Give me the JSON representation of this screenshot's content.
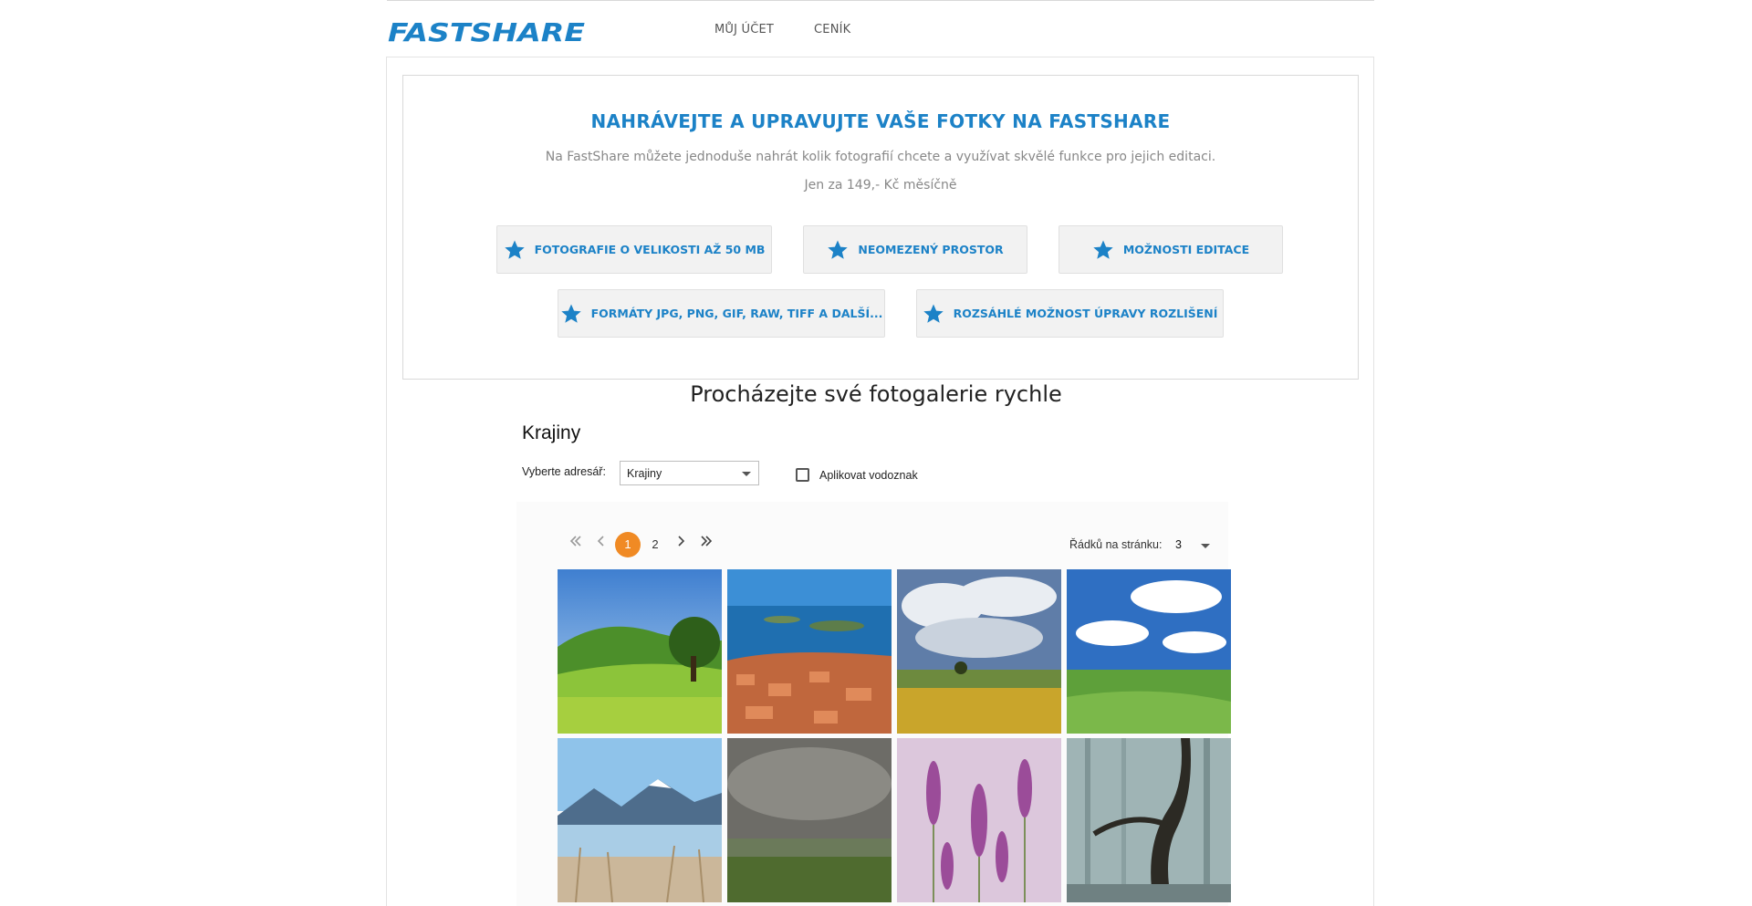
{
  "brand": {
    "logo_text": "FASTSHARE",
    "accent": "#1c82c7",
    "active_page_color": "#f08a24"
  },
  "nav": {
    "items": [
      {
        "label": "MŮJ ÚČET"
      },
      {
        "label": "CENÍK"
      }
    ]
  },
  "promo": {
    "title": "NAHRÁVEJTE A UPRAVUJTE VAŠE FOTKY NA FASTSHARE",
    "description": "Na FastShare můžete jednoduše nahrát kolik fotografií chcete a využívat skvělé funkce pro jejich editaci.",
    "price": "Jen za 149,- Kč měsíčně",
    "features": [
      {
        "label": "FOTOGRAFIE O VELIKOSTI AŽ 50 MB",
        "icon": "star-icon"
      },
      {
        "label": "NEOMEZENÝ PROSTOR",
        "icon": "star-icon"
      },
      {
        "label": "MOŽNOSTI EDITACE",
        "icon": "star-icon"
      },
      {
        "label": "FORMÁTY JPG, PNG, GIF, RAW, TIFF A DALŠÍ...",
        "icon": "star-icon"
      },
      {
        "label": "ROZSÁHLÉ MOŽNOST ÚPRAVY ROZLIŠENÍ",
        "icon": "star-icon"
      }
    ]
  },
  "gallery": {
    "heading": "Procházejte své fotogalerie rychle",
    "album_title": "Krajiny",
    "directory_label": "Vyberte adresář:",
    "directory_value": "Krajiny",
    "watermark_label": "Aplikovat vodoznak",
    "watermark_checked": false,
    "pagination": {
      "pages": [
        "1",
        "2"
      ],
      "current_page": "1",
      "icons": [
        "first-page-icon",
        "prev-page-icon",
        "next-page-icon",
        "last-page-icon"
      ]
    },
    "rows_per_page_label": "Řádků na stránku:",
    "rows_per_page_value": "3",
    "photos": [
      {
        "name": "green-meadow-tree-photo"
      },
      {
        "name": "coastal-town-islands-photo"
      },
      {
        "name": "clouds-yellow-field-photo"
      },
      {
        "name": "green-valley-clouds-photo"
      },
      {
        "name": "mountain-lake-reeds-photo"
      },
      {
        "name": "stormy-hills-photo"
      },
      {
        "name": "lavender-flowers-photo"
      },
      {
        "name": "misty-forest-tree-photo"
      }
    ]
  }
}
